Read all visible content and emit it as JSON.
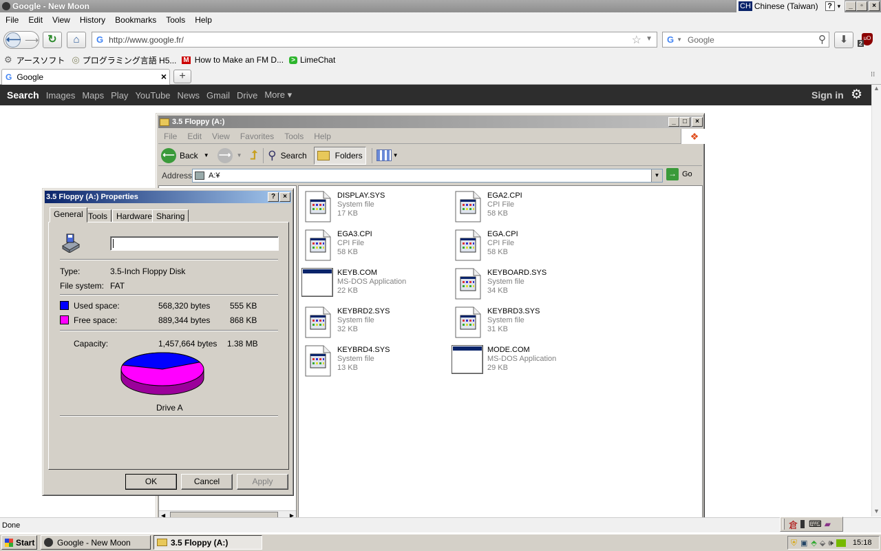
{
  "browser": {
    "window_title": "Google - New Moon",
    "language_bar": {
      "code": "CH",
      "label": "Chinese (Taiwan)"
    },
    "menu": [
      "File",
      "Edit",
      "View",
      "History",
      "Bookmarks",
      "Tools",
      "Help"
    ],
    "url": "http://www.google.fr/",
    "search_placeholder": "Google",
    "addon_badge": "2",
    "bookmarks": [
      "アースソフト",
      "プログラミング言語 H5...",
      "How to Make an FM D...",
      "LimeChat"
    ],
    "tab_title": "Google",
    "status": "Done"
  },
  "google_bar": {
    "items": [
      "Search",
      "Images",
      "Maps",
      "Play",
      "YouTube",
      "News",
      "Gmail",
      "Drive",
      "More ▾"
    ],
    "sign_in": "Sign in"
  },
  "explorer": {
    "title": "3.5 Floppy (A:)",
    "menu": [
      "File",
      "Edit",
      "View",
      "Favorites",
      "Tools",
      "Help"
    ],
    "toolbar": {
      "back": "Back",
      "search": "Search",
      "folders": "Folders"
    },
    "address_label": "Address",
    "address_value": "A:¥",
    "go_label": "Go",
    "files": [
      {
        "name": "DISPLAY.SYS",
        "type": "System file",
        "size": "17 KB",
        "icon": "sys"
      },
      {
        "name": "EGA2.CPI",
        "type": "CPI File",
        "size": "58 KB",
        "icon": "sys"
      },
      {
        "name": "EGA3.CPI",
        "type": "CPI File",
        "size": "58 KB",
        "icon": "sys"
      },
      {
        "name": "EGA.CPI",
        "type": "CPI File",
        "size": "58 KB",
        "icon": "sys"
      },
      {
        "name": "KEYB.COM",
        "type": "MS-DOS Application",
        "size": "22 KB",
        "icon": "app"
      },
      {
        "name": "KEYBOARD.SYS",
        "type": "System file",
        "size": "34 KB",
        "icon": "sys"
      },
      {
        "name": "KEYBRD2.SYS",
        "type": "System file",
        "size": "32 KB",
        "icon": "sys"
      },
      {
        "name": "KEYBRD3.SYS",
        "type": "System file",
        "size": "31 KB",
        "icon": "sys"
      },
      {
        "name": "KEYBRD4.SYS",
        "type": "System file",
        "size": "13 KB",
        "icon": "sys"
      },
      {
        "name": "MODE.COM",
        "type": "MS-DOS Application",
        "size": "29 KB",
        "icon": "app"
      }
    ]
  },
  "properties": {
    "title": "3.5 Floppy (A:) Properties",
    "tabs": [
      "General",
      "Tools",
      "Hardware",
      "Sharing"
    ],
    "label_value": "",
    "type_label": "Type:",
    "type_value": "3.5-Inch Floppy Disk",
    "fs_label": "File system:",
    "fs_value": "FAT",
    "used_label": "Used space:",
    "used_bytes": "568,320 bytes",
    "used_size": "555 KB",
    "free_label": "Free space:",
    "free_bytes": "889,344 bytes",
    "free_size": "868 KB",
    "cap_label": "Capacity:",
    "cap_bytes": "1,457,664 bytes",
    "cap_size": "1.38 MB",
    "used_fraction": 0.39,
    "used_color": "#0000ff",
    "free_color": "#ff00ff",
    "drive_label": "Drive A",
    "buttons": {
      "ok": "OK",
      "cancel": "Cancel",
      "apply": "Apply"
    }
  },
  "taskbar": {
    "start": "Start",
    "tasks": [
      "Google - New Moon",
      "3.5 Floppy (A:)"
    ],
    "clock": "15:18"
  }
}
